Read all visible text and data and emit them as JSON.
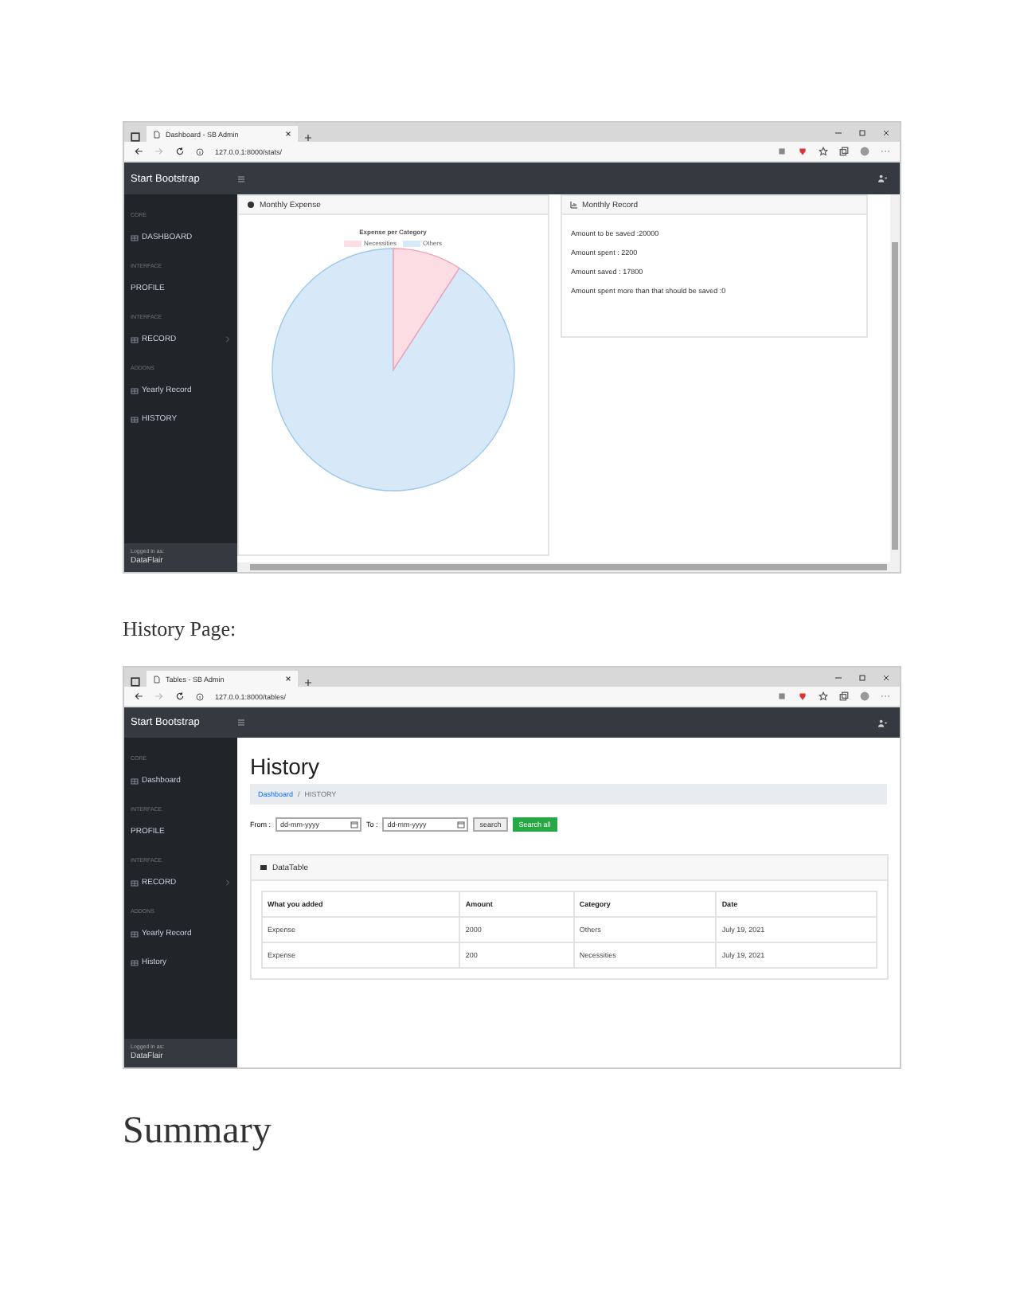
{
  "dashboard_window": {
    "tab_title": "Dashboard - SB Admin",
    "url": "127.0.0.1:8000/stats/",
    "brand": "Start Bootstrap",
    "sidebar": {
      "sections": [
        {
          "heading": "CORE",
          "items": [
            {
              "label": "DASHBOARD",
              "has_icon": true,
              "expandable": false
            }
          ]
        },
        {
          "heading": "INTERFACE",
          "items": [
            {
              "label": "PROFILE",
              "has_icon": false,
              "expandable": false
            }
          ]
        },
        {
          "heading": "INTERFACE",
          "items": [
            {
              "label": "RECORD",
              "has_icon": true,
              "expandable": true
            }
          ]
        },
        {
          "heading": "ADDONS",
          "items": [
            {
              "label": "Yearly Record",
              "has_icon": true,
              "expandable": false
            },
            {
              "label": "HISTORY",
              "has_icon": true,
              "expandable": false
            }
          ]
        }
      ],
      "footer_label": "Logged in as:",
      "footer_user": "DataFlair"
    },
    "expense_card": {
      "title": "Monthly Expense",
      "chart_title": "Expense per Category",
      "legend": [
        {
          "label": "Necessities",
          "color": "#fcdde4"
        },
        {
          "label": "Others",
          "color": "#d7e9f8"
        }
      ]
    },
    "record_card": {
      "title": "Monthly Record",
      "lines": [
        "Amount to be saved :20000",
        "Amount spent : 2200",
        "Amount saved : 17800",
        "Amount spent more than that should be saved :0"
      ]
    }
  },
  "caption": "History Page:",
  "history_window": {
    "tab_title": "Tables - SB Admin",
    "url": "127.0.0.1:8000/tables/",
    "brand": "Start Bootstrap",
    "sidebar": {
      "sections": [
        {
          "heading": "CORE",
          "items": [
            {
              "label": "Dashboard",
              "has_icon": true,
              "expandable": false
            }
          ]
        },
        {
          "heading": "INTERFACE",
          "items": [
            {
              "label": "PROFILE",
              "has_icon": false,
              "expandable": false
            }
          ]
        },
        {
          "heading": "INTERFACE",
          "items": [
            {
              "label": "RECORD",
              "has_icon": true,
              "expandable": true
            }
          ]
        },
        {
          "heading": "ADDONS",
          "items": [
            {
              "label": "Yearly Record",
              "has_icon": true,
              "expandable": false
            },
            {
              "label": "History",
              "has_icon": true,
              "expandable": false
            }
          ]
        }
      ],
      "footer_label": "Logged in as:",
      "footer_user": "DataFlair"
    },
    "heading": "History",
    "breadcrumb": {
      "link": "Dashboard",
      "separator": "/",
      "current": "HISTORY"
    },
    "filter": {
      "from_label": "From :",
      "from_placeholder": "dd-mm-yyyy",
      "to_label": "To :",
      "to_placeholder": "dd-mm-yyyy",
      "search_button": "search",
      "search_all_button": "Search all"
    },
    "table_card": {
      "title": "DataTable",
      "columns": [
        "What you added",
        "Amount",
        "Category",
        "Date"
      ],
      "rows": [
        [
          "Expense",
          "2000",
          "Others",
          "July 19, 2021"
        ],
        [
          "Expense",
          "200",
          "Necessities",
          "July 19, 2021"
        ]
      ]
    }
  },
  "summary_heading": "Summary"
}
